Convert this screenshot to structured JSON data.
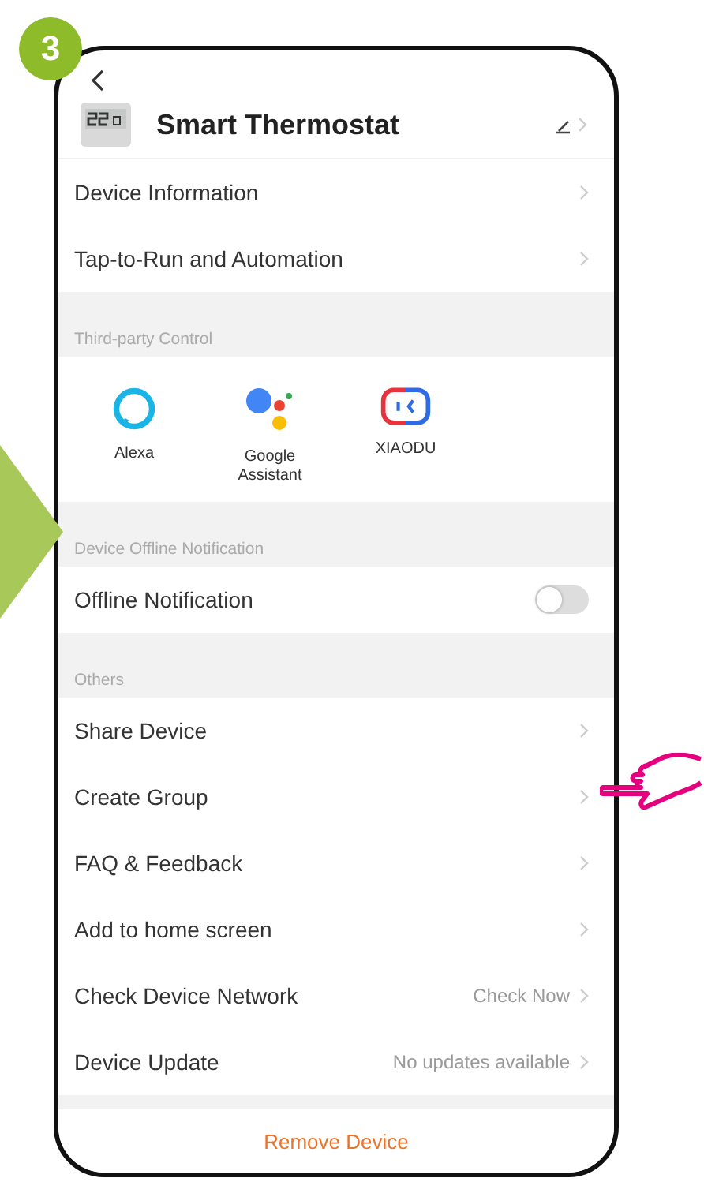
{
  "step_badge": "3",
  "device": {
    "name": "Smart Thermostat"
  },
  "top_items": [
    {
      "label": "Device Information"
    },
    {
      "label": "Tap-to-Run and Automation"
    }
  ],
  "third_party": {
    "header": "Third-party Control",
    "services": [
      {
        "kind": "alexa",
        "label": "Alexa"
      },
      {
        "kind": "google",
        "label": "Google Assistant"
      },
      {
        "kind": "xiaodu",
        "label": "XIAODU"
      }
    ]
  },
  "offline": {
    "header": "Device Offline Notification",
    "label": "Offline Notification",
    "on": false
  },
  "others": {
    "header": "Others",
    "items": [
      {
        "label": "Share Device"
      },
      {
        "label": "Create Group"
      },
      {
        "label": "FAQ & Feedback"
      },
      {
        "label": "Add to home screen"
      },
      {
        "label": "Check Device Network",
        "value": "Check Now"
      },
      {
        "label": "Device Update",
        "value": "No updates available"
      }
    ]
  },
  "remove_button": "Remove Device"
}
